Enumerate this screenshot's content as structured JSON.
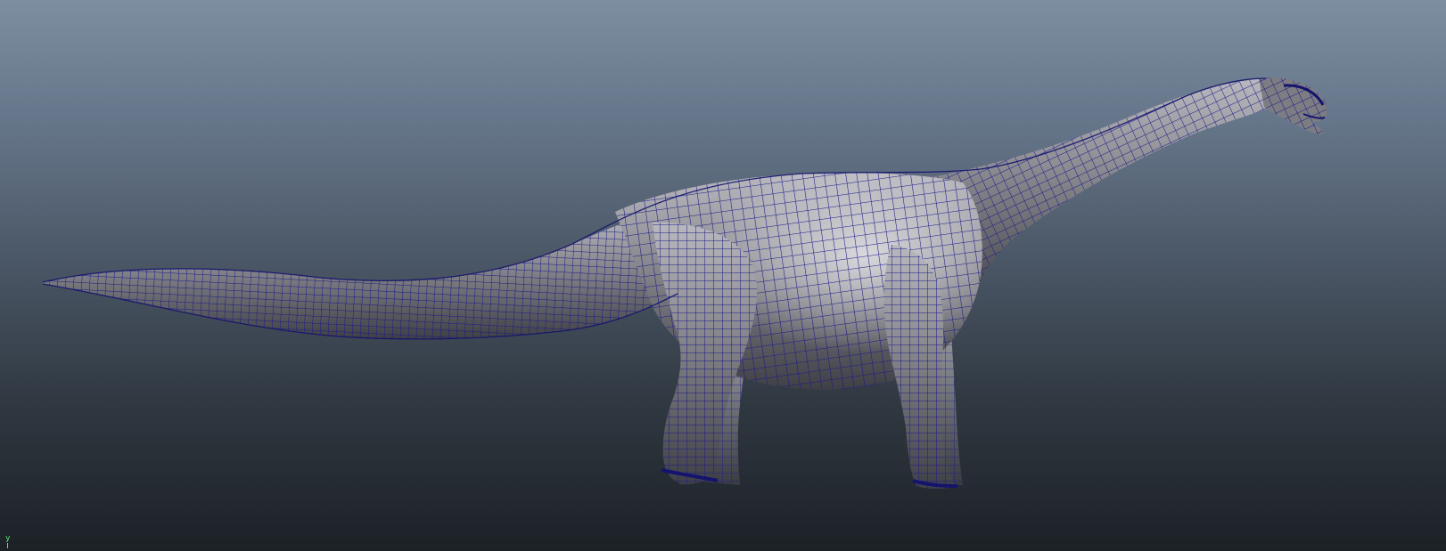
{
  "viewport": {
    "background_top": "#7d8ea1",
    "background_bottom": "#1c2126",
    "wireframe_color": "#1b1a8a",
    "shaded_color": "#8e8e93",
    "axis_color": "#62e36b"
  },
  "model": {
    "icon": "sauropod-wireframe-model"
  },
  "axis_gizmo": {
    "label": "y"
  }
}
